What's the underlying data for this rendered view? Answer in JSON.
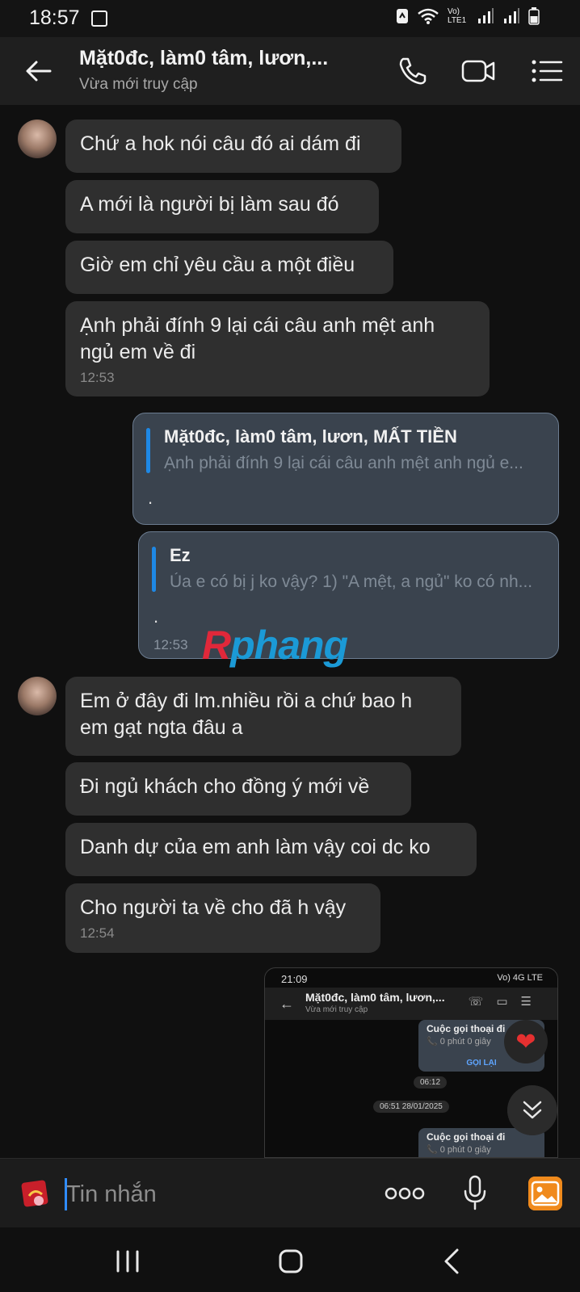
{
  "status_bar": {
    "time": "18:57",
    "network_label": "Vo) LTE1"
  },
  "header": {
    "title": "Mặt0đc, làm0 tâm, lươn,...",
    "subtitle": "Vừa mới truy cập"
  },
  "messages": [
    {
      "text": "Chứ a hok nói câu đó ai dám đi"
    },
    {
      "text": "A mới là người bị làm sau đó"
    },
    {
      "text": "Giờ em chỉ yêu cầu a một điều"
    },
    {
      "text_line1": "Ạnh phải đính 9 lại cái câu anh mệt anh",
      "text_line2": "ngủ em về đi",
      "time": "12:53"
    },
    {
      "quote_name": "Mặt0đc, làm0 tâm, lươn, MẤT TIỀN",
      "quote_text": "Ạnh phải đính 9 lại cái câu anh mệt anh ngủ e...",
      "body": "."
    },
    {
      "quote_name": "Ez",
      "quote_text": "Ủa e có bị j ko vậy? 1) \"A mệt, a ngủ\" ko có nh...",
      "body": ".",
      "time": "12:53"
    },
    {
      "text_line1": "Em ở đây đi lm.nhiều rồi a chứ bao h",
      "text_line2": "em gạt ngta đâu a"
    },
    {
      "text": "Đi ngủ khách cho đồng ý mới về"
    },
    {
      "text": "Danh dự của em anh làm vậy coi dc ko"
    },
    {
      "text": "Cho người ta về cho đã h vậy",
      "time": "12:54"
    }
  ],
  "watermark": {
    "part1": "R",
    "part2": "phang"
  },
  "image_message": {
    "status_time": "21:09",
    "status_right": "Vo) 4G LTE",
    "title": "Mặt0đc, làm0 tâm, lươn,...",
    "subtitle": "Vừa mới truy cập",
    "card1_title": "Cuộc gọi thoại đi",
    "card1_sub": "📞 0 phút 0 giây",
    "card1_button": "GỌI LẠI",
    "time1": "06:12",
    "date_pill": "06:51 28/01/2025",
    "card2_title": "Cuộc gọi thoại đi",
    "card2_sub": "📞 0 phút 0 giây"
  },
  "reaction": "❤",
  "input": {
    "placeholder": "Tin nhắn"
  },
  "icons": {
    "back": "back-arrow-icon",
    "call": "phone-icon",
    "video": "video-camera-icon",
    "menu": "list-menu-icon",
    "sticker": "sticker-icon",
    "more": "more-dots-icon",
    "mic": "microphone-icon",
    "gallery": "gallery-icon",
    "scroll": "double-chevron-down-icon"
  },
  "colors": {
    "accent": "#1e88e5",
    "bubble": "#2f2f2f",
    "reply_bubble": "#3a434e",
    "gallery": "#f08a1c"
  }
}
